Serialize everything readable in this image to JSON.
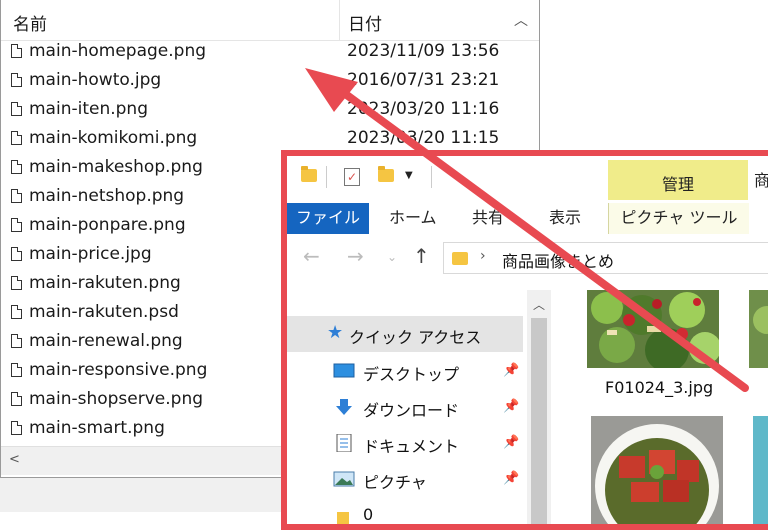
{
  "file_list": {
    "header": {
      "name": "名前",
      "date": "日付"
    },
    "rows": [
      {
        "name": "main-homepage.png",
        "date": "2023/11/09 13:56"
      },
      {
        "name": "main-howto.jpg",
        "date": "2016/07/31 23:21"
      },
      {
        "name": "main-iten.png",
        "date": "2023/03/20 11:16"
      },
      {
        "name": "main-komikomi.png",
        "date": "2023/03/20 11:15"
      },
      {
        "name": "main-makeshop.png",
        "date": ""
      },
      {
        "name": "main-netshop.png",
        "date": ""
      },
      {
        "name": "main-ponpare.png",
        "date": ""
      },
      {
        "name": "main-price.jpg",
        "date": ""
      },
      {
        "name": "main-rakuten.png",
        "date": ""
      },
      {
        "name": "main-rakuten.psd",
        "date": ""
      },
      {
        "name": "main-renewal.png",
        "date": ""
      },
      {
        "name": "main-responsive.png",
        "date": ""
      },
      {
        "name": "main-shopserve.png",
        "date": ""
      },
      {
        "name": "main-smart.png",
        "date": ""
      }
    ]
  },
  "explorer": {
    "context_tab_header": "管理",
    "context_tab_extra": "商",
    "ribbon_tabs": {
      "file": "ファイル",
      "home": "ホーム",
      "share": "共有",
      "view": "表示",
      "picture_tools": "ピクチャ ツール"
    },
    "address_path": "商品画像まとめ",
    "nav": {
      "quick_access": "クイック アクセス",
      "items": [
        {
          "label": "デスクトップ",
          "icon": "desktop-icon"
        },
        {
          "label": "ダウンロード",
          "icon": "download-icon"
        },
        {
          "label": "ドキュメント",
          "icon": "document-icon"
        },
        {
          "label": "ピクチャ",
          "icon": "pictures-icon"
        },
        {
          "label": "0",
          "icon": "folder-icon"
        }
      ]
    },
    "thumbnail_name": "F01024_3.jpg"
  },
  "colors": {
    "highlight_border": "#e84a51",
    "file_tab": "#1565c0",
    "context_tab": "#f0ec8a"
  }
}
